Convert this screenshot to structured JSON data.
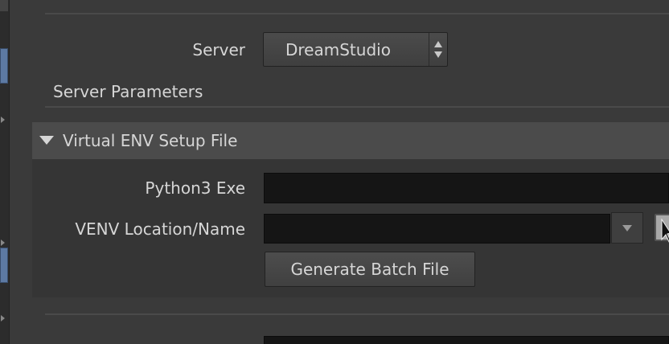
{
  "server": {
    "label": "Server",
    "value": "DreamStudio"
  },
  "server_parameters": {
    "heading": "Server Parameters"
  },
  "venv_folder": {
    "title": "Virtual ENV Setup File",
    "expanded": true,
    "python_exe": {
      "label": "Python3 Exe",
      "value": ""
    },
    "venv_location": {
      "label": "VENV Location/Name",
      "value": ""
    },
    "generate_button_label": "Generate Batch File"
  },
  "colors": {
    "background": "#3a3a3a",
    "folder_header": "#4b4b4b",
    "field": "#151515",
    "text": "#d6d6d6"
  }
}
